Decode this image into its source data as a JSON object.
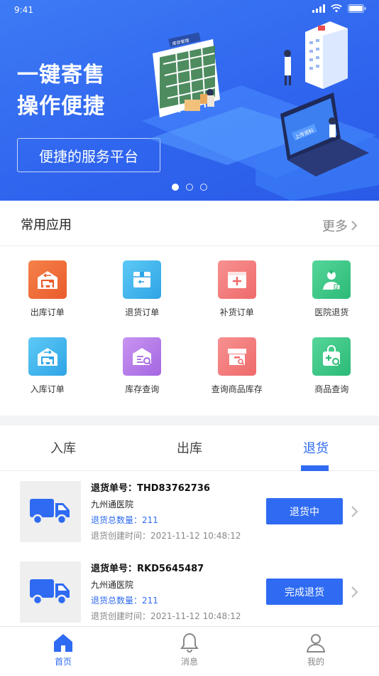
{
  "status": {
    "time": "9:41"
  },
  "banner": {
    "line1": "一键寄售",
    "line2": "操作便捷",
    "pill": "便捷的服务平台",
    "illus_sign": "库存管理",
    "illus_upload": "上传资料",
    "slides": 3,
    "active_slide": 1
  },
  "apps": {
    "title": "常用应用",
    "more": "更多",
    "items": [
      {
        "label": "出库订单",
        "icon": "warehouse-out-icon",
        "color": "#f0703b"
      },
      {
        "label": "退货订单",
        "icon": "return-box-icon",
        "color": "#3fb8ee"
      },
      {
        "label": "补货订单",
        "icon": "medical-kit-icon",
        "color": "#f37a7a"
      },
      {
        "label": "医院退货",
        "icon": "doctor-icon",
        "color": "#3dc98a"
      },
      {
        "label": "入库订单",
        "icon": "warehouse-in-icon",
        "color": "#3fb8ee"
      },
      {
        "label": "库存查询",
        "icon": "inventory-search-icon",
        "color": "#b57be8"
      },
      {
        "label": "查询商品库存",
        "icon": "archive-search-icon",
        "color": "#f37a7a"
      },
      {
        "label": "商品查询",
        "icon": "bag-search-icon",
        "color": "#3dc98a"
      }
    ]
  },
  "tabs": {
    "items": [
      "入库",
      "出库",
      "退货"
    ],
    "active": 2
  },
  "orders": [
    {
      "no_label": "退货单号：",
      "no": "THD83762736",
      "hospital": "九州通医院",
      "qty_label": "退货总数量：",
      "qty": "211",
      "time_label": "退货创建时间：",
      "time": "2021-11-12   10:48:12",
      "status": "退货中"
    },
    {
      "no_label": "退货单号：",
      "no": "RKD5645487",
      "hospital": "九州通医院",
      "qty_label": "退货总数量：",
      "qty": "211",
      "time_label": "退货创建时间：",
      "time": "2021-11-12   10:48:12",
      "status": "完成退货"
    }
  ],
  "nav": [
    {
      "label": "首页",
      "icon": "home-icon",
      "active": true
    },
    {
      "label": "消息",
      "icon": "bell-icon",
      "active": false
    },
    {
      "label": "我的",
      "icon": "user-icon",
      "active": false
    }
  ],
  "colors": {
    "primary": "#2f6bf2"
  }
}
